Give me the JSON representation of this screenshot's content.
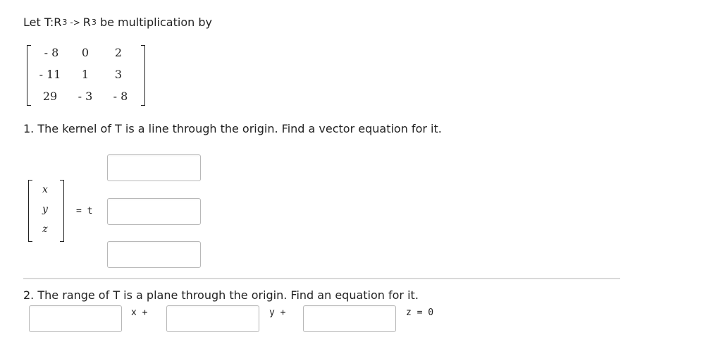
{
  "intro": {
    "prefix": "Let T:R",
    "sup1": "3",
    "arrow": "->",
    "r": "R",
    "sup2": "3",
    "suffix": "be multiplication by"
  },
  "matrix": [
    [
      "- 8",
      "0",
      "2"
    ],
    [
      "- 11",
      "1",
      "3"
    ],
    [
      "29",
      "- 3",
      "- 8"
    ]
  ],
  "question1": "1. The kernel of T is a line through the origin. Find a vector equation for it.",
  "vector_vars": [
    "x",
    "y",
    "z"
  ],
  "eq_label": "= t",
  "question2": "2. The range of T is a plane through the origin. Find an equation for it.",
  "plane": {
    "x_label": "x +",
    "y_label": "y +",
    "z_label": "z = 0"
  },
  "inputs": {
    "k1": "",
    "k2": "",
    "k3": "",
    "a": "",
    "b": "",
    "c": ""
  }
}
